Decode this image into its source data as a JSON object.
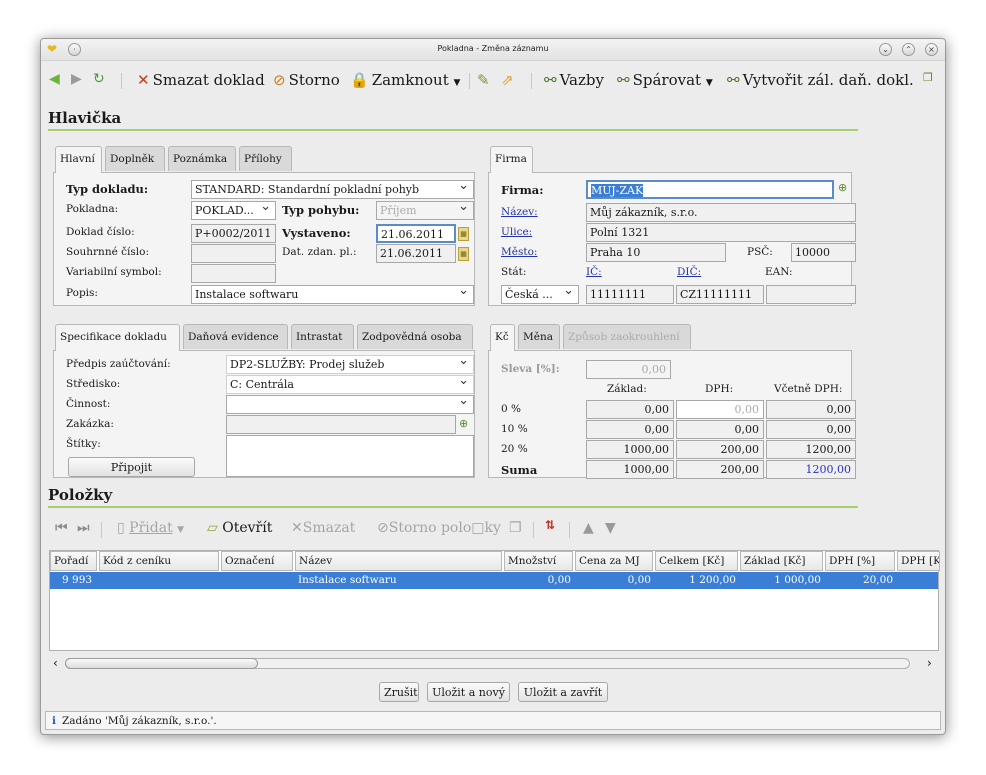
{
  "window": {
    "title": "Pokladna - Změna záznamu"
  },
  "toolbar": {
    "delete": "Smazat doklad",
    "storno": "Storno",
    "lock": "Zamknout",
    "links": "Vazby",
    "pair": "Spárovat",
    "create_advance": "Vytvořit zál. daň. dokl."
  },
  "header": {
    "section_title": "Hlavička",
    "tabs": [
      "Hlavní",
      "Doplněk",
      "Poznámka",
      "Přílohy"
    ]
  },
  "main": {
    "doc_type_label": "Typ dokladu:",
    "doc_type_value": "STANDARD: Standardní pokladní pohyb",
    "cashbox_label": "Pokladna:",
    "cashbox_value": "POKLAD...",
    "movement_label": "Typ pohybu:",
    "movement_value": "Příjem",
    "doc_number_label": "Doklad číslo:",
    "doc_number_value": "P+0002/2011",
    "issued_label": "Vystaveno:",
    "issued_value": "21.06.2011",
    "summary_number_label": "Souhrnné číslo:",
    "summary_number_value": "",
    "tax_date_label": "Dat. zdan. pl.:",
    "tax_date_value": "21.06.2011",
    "variable_symbol_label": "Variabilní symbol:",
    "variable_symbol_value": "",
    "description_label": "Popis:",
    "description_value": "Instalace softwaru"
  },
  "firm": {
    "tab": "Firma",
    "firm_label": "Firma:",
    "firm_value": "MUJ-ZAK",
    "name_label": "Název:",
    "name_value": "Můj zákazník, s.r.o.",
    "street_label": "Ulice:",
    "street_value": "Polní 1321",
    "city_label": "Město:",
    "city_value": "Praha 10",
    "zip_label": "PSČ:",
    "zip_value": "10000",
    "country_label": "Stát:",
    "country_value": "Česká ...",
    "ic_label": "IČ:",
    "ic_value": "11111111",
    "dic_label": "DIČ:",
    "dic_value": "CZ11111111",
    "ean_label": "EAN:",
    "ean_value": ""
  },
  "spec": {
    "tabs": [
      "Specifikace dokladu",
      "Daňová evidence",
      "Intrastat",
      "Zodpovědná osoba"
    ],
    "posting_label": "Předpis zaúčtování:",
    "posting_value": "DP2-SLUŽBY: Prodej služeb",
    "center_label": "Středisko:",
    "center_value": "C: Centrála",
    "activity_label": "Činnost:",
    "activity_value": "",
    "contract_label": "Zakázka:",
    "contract_value": "",
    "tags_label": "Štítky:",
    "attach_button": "Připojit"
  },
  "sums": {
    "tabs": [
      "Kč",
      "Měna",
      "Způsob zaokrouhlení"
    ],
    "discount_label": "Sleva [%]:",
    "discount_value": "0,00",
    "col_base": "Základ:",
    "col_vat": "DPH:",
    "col_total": "Včetně DPH:",
    "rows": [
      {
        "rate": "0 %",
        "base": "0,00",
        "vat": "0,00",
        "total": "0,00"
      },
      {
        "rate": "10 %",
        "base": "0,00",
        "vat": "0,00",
        "total": "0,00"
      },
      {
        "rate": "20 %",
        "base": "1000,00",
        "vat": "200,00",
        "total": "1200,00"
      },
      {
        "rate": "Suma",
        "base": "1000,00",
        "vat": "200,00",
        "total": "1200,00"
      }
    ]
  },
  "items": {
    "section_title": "Položky",
    "add": "Přidat",
    "open": "Otevřít",
    "delete": "Smazat",
    "storno": "Storno polo□ky",
    "columns": [
      "Pořadí",
      "Kód z ceníku",
      "Označení",
      "Název",
      "Množství",
      "Cena za MJ",
      "Celkem [Kč]",
      "Základ [Kč]",
      "DPH [%]",
      "DPH [K"
    ],
    "rows": [
      {
        "order": "9 993",
        "code": "",
        "mark": "",
        "name": "Instalace softwaru",
        "qty": "0,00",
        "price": "0,00",
        "total": "1 200,00",
        "base": "1 000,00",
        "vat_pct": "20,00",
        "vat": ""
      }
    ]
  },
  "footer": {
    "cancel": "Zrušit",
    "save_new": "Uložit a nový",
    "save_close": "Uložit a zavřít"
  },
  "status": {
    "icon": "i",
    "text": "Zadáno 'Můj zákazník, s.r.o.'."
  }
}
